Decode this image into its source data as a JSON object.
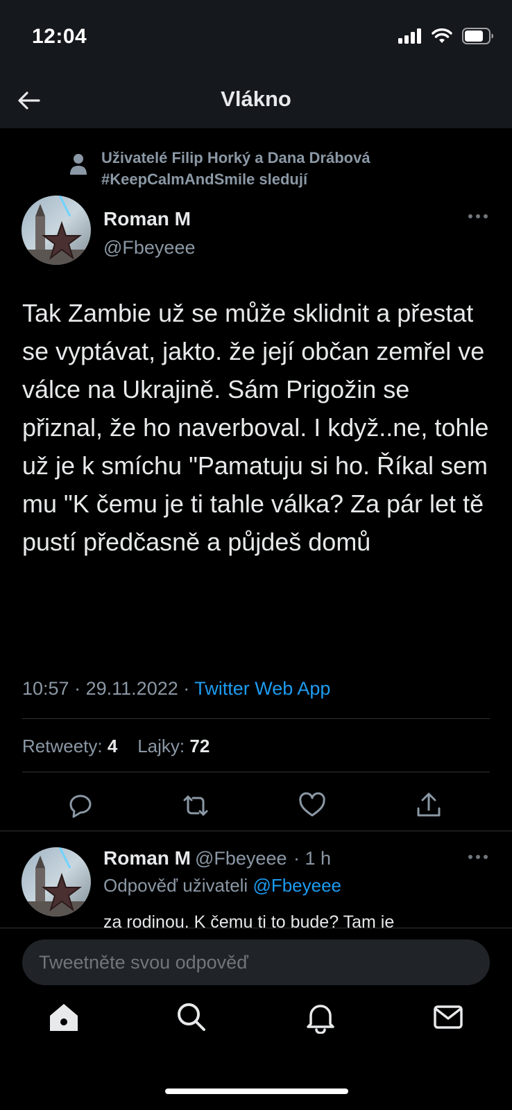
{
  "status_bar": {
    "time": "12:04",
    "icons": [
      "signal-icon",
      "wifi-icon",
      "battery-icon"
    ]
  },
  "header": {
    "title": "Vlákno",
    "back_icon": "arrow-left-icon"
  },
  "social_context": {
    "text": "Uživatelé Filip Horký a Dana Drábová #KeepCalmAndSmile sledují",
    "icon": "person-icon"
  },
  "tweet": {
    "author_name": "Roman M",
    "author_handle": "@Fbeyeee",
    "text": "Tak Zambie už se může sklidnit a přestat se vyptávat, jakto. že její občan zemřel ve válce na Ukrajině. Sám Prigožin se přiznal, že ho naverboval. I když..ne, tohle už je k smíchu \"Pamatuju si ho. Říkal sem mu \"K čemu je ti tahle válka? Za pár let tě pustí předčasně a půjdeš domů",
    "time": "10:57",
    "date": "29.11.2022",
    "separator": "·",
    "source": "Twitter Web App",
    "retweets_label": "Retweety:",
    "retweets_count": "4",
    "likes_label": "Lajky:",
    "likes_count": "72"
  },
  "reply": {
    "author_name": "Roman M",
    "author_handle": "@Fbeyeee",
    "time": "· 1 h",
    "reply_to_label": "Odpověď uživateli",
    "reply_to_handle": "@Fbeyeee",
    "text": "za rodinou. K čemu ti to bude? Tam je"
  },
  "composer": {
    "placeholder": "Tweetněte svou odpověď"
  },
  "tabbar": [
    "home-icon",
    "search-icon",
    "notifications-icon",
    "messages-icon"
  ],
  "colors": {
    "accent": "#1d9bf0",
    "background": "#000000",
    "header_bg": "#15181c",
    "secondary_text": "#8b98a5"
  }
}
